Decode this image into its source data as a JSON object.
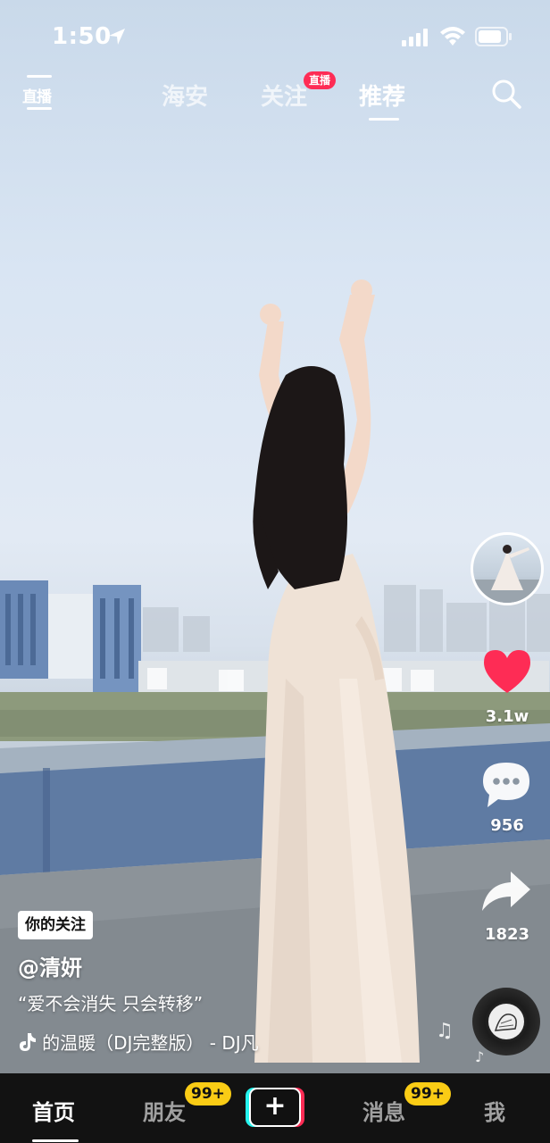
{
  "status_bar": {
    "time": "1:50",
    "icons": [
      "location-arrow-icon",
      "cellular-signal-icon",
      "wifi-icon",
      "battery-icon"
    ]
  },
  "top_nav": {
    "live_icon_label": "直播",
    "tabs": [
      {
        "label": "海安",
        "active": false
      },
      {
        "label": "关注",
        "active": false,
        "badge": "直播"
      },
      {
        "label": "推荐",
        "active": true
      }
    ],
    "search_icon": "search-icon"
  },
  "actions": {
    "like_count": "3.1w",
    "comment_count": "956",
    "share_count": "1823",
    "like_color": "#fe2c55"
  },
  "caption": {
    "follow_tag": "你的关注",
    "author": "@清妍",
    "description": "“爱不会消失 只会转移”",
    "music": "的温暖（DJ完整版） - DJ凡"
  },
  "tab_bar": {
    "items": [
      {
        "label": "首页",
        "active": true
      },
      {
        "label": "朋友",
        "badge": "99+"
      },
      {
        "label": "+",
        "type": "create"
      },
      {
        "label": "消息",
        "badge": "99+"
      },
      {
        "label": "我"
      }
    ],
    "badge_color": "#facc15"
  }
}
